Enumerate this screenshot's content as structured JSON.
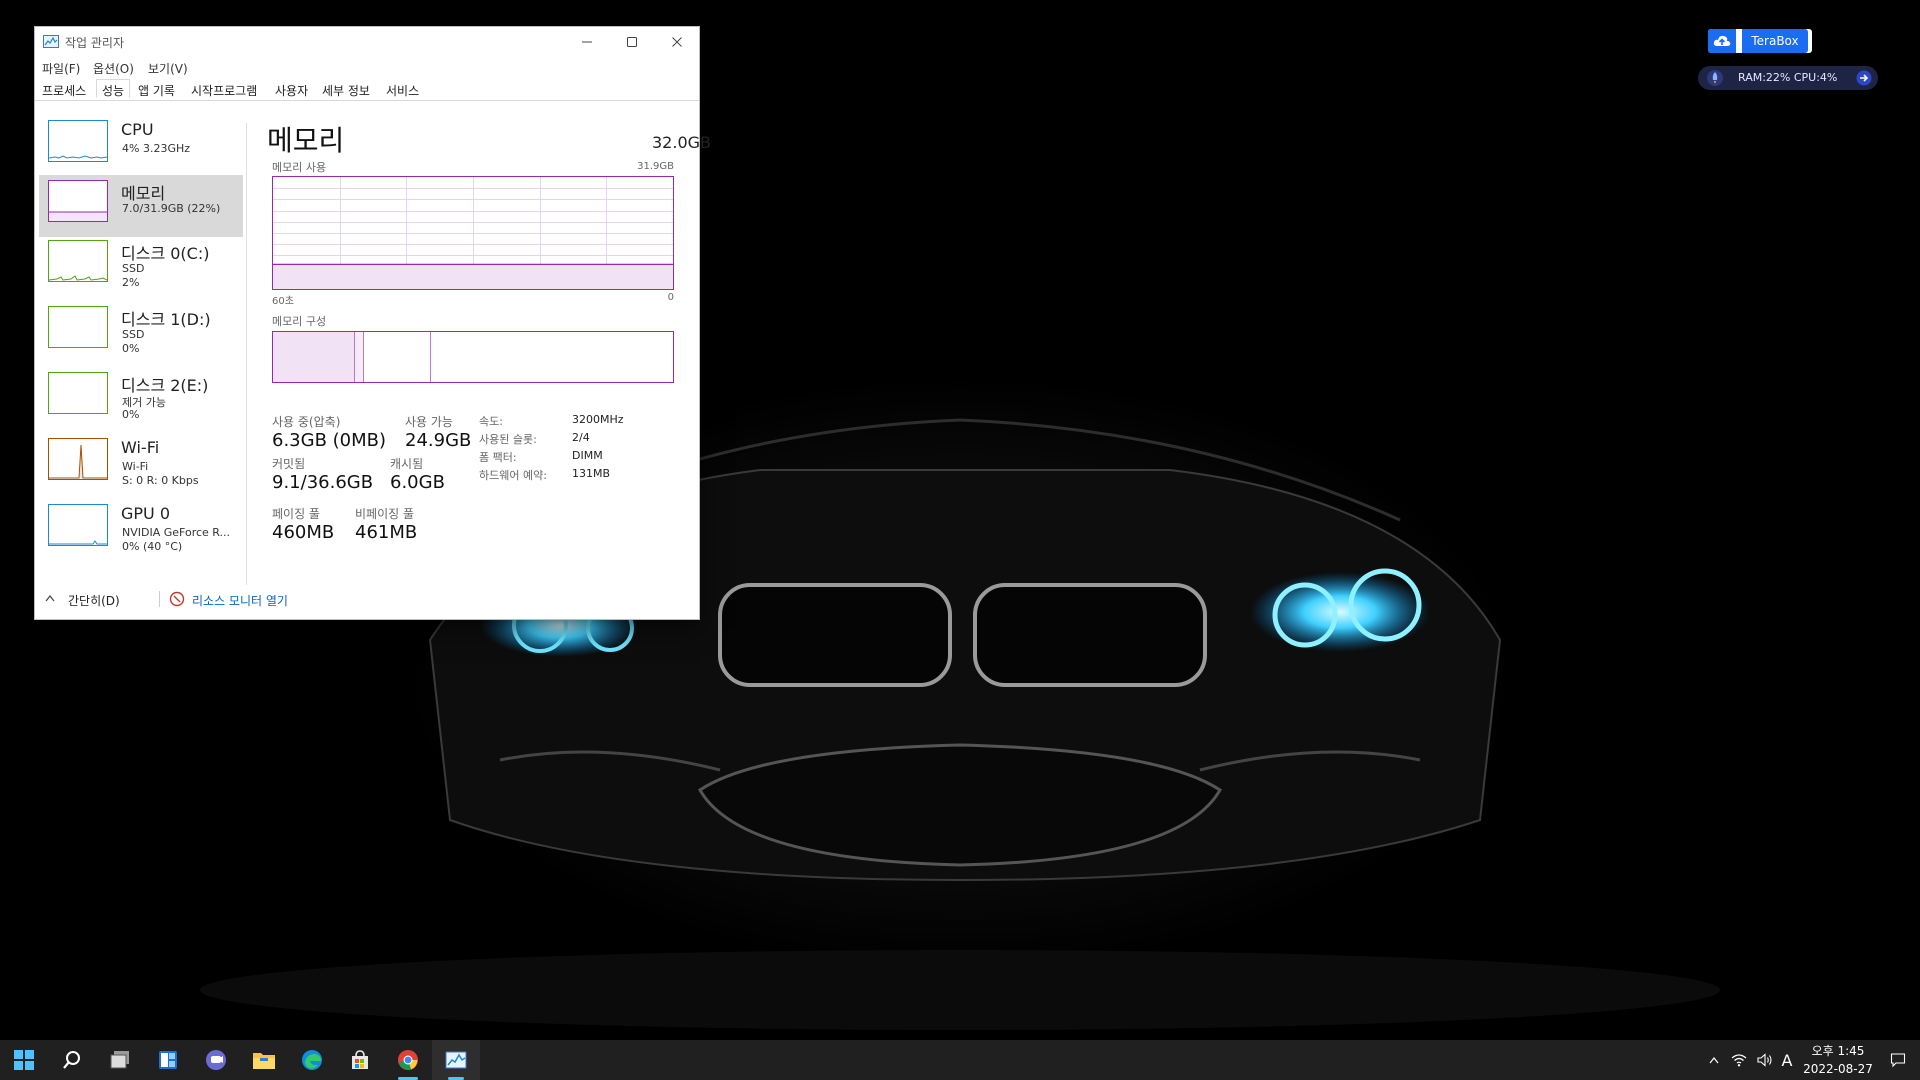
{
  "window": {
    "title": "작업 관리자",
    "menus": [
      "파일(F)",
      "옵션(O)",
      "보기(V)"
    ],
    "tabs": [
      "프로세스",
      "성능",
      "앱 기록",
      "시작프로그램",
      "사용자",
      "세부 정보",
      "서비스"
    ],
    "active_tab": "성능"
  },
  "sidebar": [
    {
      "name": "CPU",
      "lines": [
        "4% 3.23GHz"
      ],
      "color": "#1a8ad4"
    },
    {
      "name": "메모리",
      "lines": [
        "7.0/31.9GB (22%)"
      ],
      "color": "#9528b4"
    },
    {
      "name": "디스크 0(C:)",
      "lines": [
        "SSD",
        "2%"
      ],
      "color": "#4da60c"
    },
    {
      "name": "디스크 1(D:)",
      "lines": [
        "SSD",
        "0%"
      ],
      "color": "#4da60c"
    },
    {
      "name": "디스크 2(E:)",
      "lines": [
        "제거 가능",
        "0%"
      ],
      "color": "#4da60c"
    },
    {
      "name": "Wi-Fi",
      "lines": [
        "Wi-Fi",
        "S: 0 R: 0 Kbps"
      ],
      "color": "#a74f01"
    },
    {
      "name": "GPU 0",
      "lines": [
        "NVIDIA GeForce R...",
        "0% (40 °C)"
      ],
      "color": "#1a8ad4"
    }
  ],
  "memory": {
    "title": "메모리",
    "total": "32.0GB",
    "usage_label": "메모리 사용",
    "usage_max": "31.9GB",
    "axis_left": "60초",
    "axis_right": "0",
    "usage_fraction": 0.22,
    "composition_label": "메모리 구성",
    "stats": {
      "in_use_label": "사용 중(압축)",
      "in_use_value": "6.3GB (0MB)",
      "available_label": "사용 가능",
      "available_value": "24.9GB",
      "committed_label": "커밋됨",
      "committed_value": "9.1/36.6GB",
      "cached_label": "캐시됨",
      "cached_value": "6.0GB",
      "paged_label": "페이징 풀",
      "paged_value": "460MB",
      "nonpaged_label": "비페이징 풀",
      "nonpaged_value": "461MB"
    },
    "details": [
      {
        "key": "속도:",
        "value": "3200MHz"
      },
      {
        "key": "사용된 슬롯:",
        "value": "2/4"
      },
      {
        "key": "폼 팩터:",
        "value": "DIMM"
      },
      {
        "key": "하드웨어 예약:",
        "value": "131MB"
      }
    ]
  },
  "footer": {
    "fewer_details": "간단히(D)",
    "resource_monitor": "리소스 모니터 열기"
  },
  "widgets": {
    "terabox": "TeraBox",
    "ramcpu": "RAM:22%   CPU:4%"
  },
  "taskbar": {
    "apps": [
      "start-icon",
      "search-icon",
      "task-view-icon",
      "widgets-icon",
      "teams-chat-icon",
      "file-explorer-icon",
      "edge-icon",
      "store-icon",
      "chrome-icon",
      "task-manager-icon"
    ],
    "ime": "A",
    "time": "오후 1:45",
    "date": "2022-08-27"
  },
  "colors": {
    "memory_accent": "#9528b4",
    "cpu_accent": "#1a8ad4",
    "disk_accent": "#4da60c",
    "wifi_accent": "#a74f01",
    "taskbar_bg": "#202020",
    "link": "#0066cc"
  }
}
